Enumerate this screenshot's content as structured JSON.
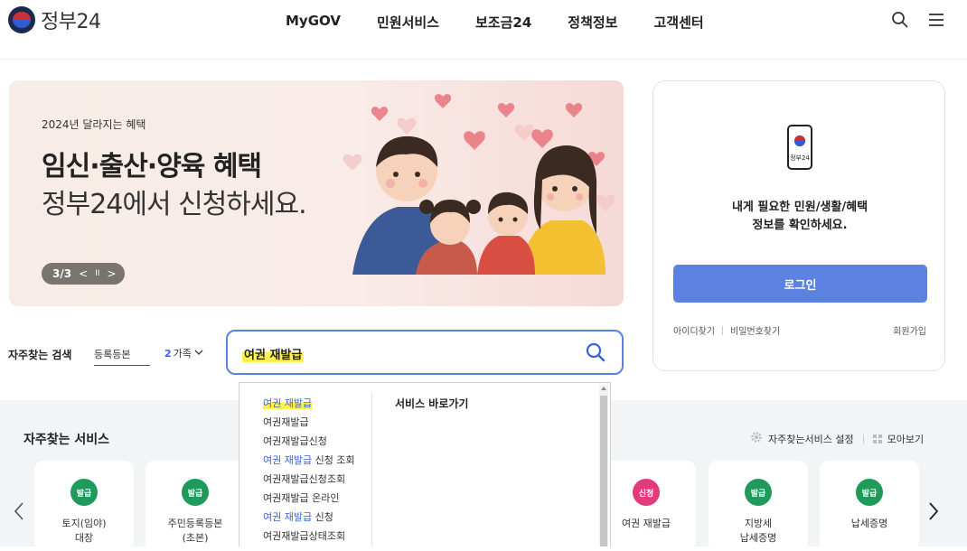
{
  "header": {
    "logo_text": "정부24",
    "nav": [
      "MyGOV",
      "민원서비스",
      "보조금24",
      "정책정보",
      "고객센터"
    ],
    "icons": [
      "search-icon",
      "hamburger-menu-icon"
    ]
  },
  "banner": {
    "subtitle": "2024년 달라지는 혜택",
    "title": "임신·출산·양육 혜택",
    "title2": "정부24에서 신청하세요.",
    "pager": {
      "current": "3/3",
      "prev": "<",
      "pause": "II",
      "next": ">"
    }
  },
  "login": {
    "app_label": "정부24",
    "message_line1": "내게 필요한 민원/생활/혜택",
    "message_line2": "정보를 확인하세요.",
    "button": "로그인",
    "find_id": "아이디찾기",
    "find_pw": "비밀번호찾기",
    "signup": "회원가입"
  },
  "frequent": {
    "label": "자주찾는 검색",
    "keyword": "등록등본",
    "more_num": "2",
    "more_text": "가족"
  },
  "search": {
    "value": "여권 재발급"
  },
  "dropdown": {
    "items": [
      {
        "prefix": "",
        "match": "여권 재발급",
        "rest": "",
        "style": "highlight"
      },
      {
        "prefix": "여권재발급",
        "match": "",
        "rest": "",
        "style": "plain"
      },
      {
        "prefix": "여권재발급신청",
        "match": "",
        "rest": "",
        "style": "plain"
      },
      {
        "prefix": "",
        "match": "여권 재발급",
        "rest": " 신청 조회",
        "style": "blue"
      },
      {
        "prefix": "여권재발급신청조회",
        "match": "",
        "rest": "",
        "style": "plain"
      },
      {
        "prefix": "여권재발급 온라인",
        "match": "",
        "rest": "",
        "style": "plain"
      },
      {
        "prefix": "",
        "match": "여권 재발급",
        "rest": " 신청",
        "style": "blue"
      },
      {
        "prefix": "여권재발급상태조회",
        "match": "",
        "rest": "",
        "style": "plain"
      }
    ],
    "right_title": "서비스 바로가기"
  },
  "services": {
    "title": "자주찾는 서비스",
    "settings": "자주찾는서비스 설정",
    "view_all": "모아보기",
    "cards": [
      {
        "badge": "발급",
        "name1": "토지(임야)",
        "name2": "대장",
        "color": "#1f9a5a"
      },
      {
        "badge": "발급",
        "name1": "주민등록등본",
        "name2": "(초본)",
        "color": "#1f9a5a"
      },
      {
        "badge": "신청",
        "name1": "여권 재발급",
        "name2": "",
        "color": "#e23a7a"
      },
      {
        "badge": "발급",
        "name1": "지방세",
        "name2": "납세증명",
        "color": "#1f9a5a"
      },
      {
        "badge": "발급",
        "name1": "납세증명",
        "name2": "",
        "color": "#1f9a5a"
      }
    ]
  }
}
